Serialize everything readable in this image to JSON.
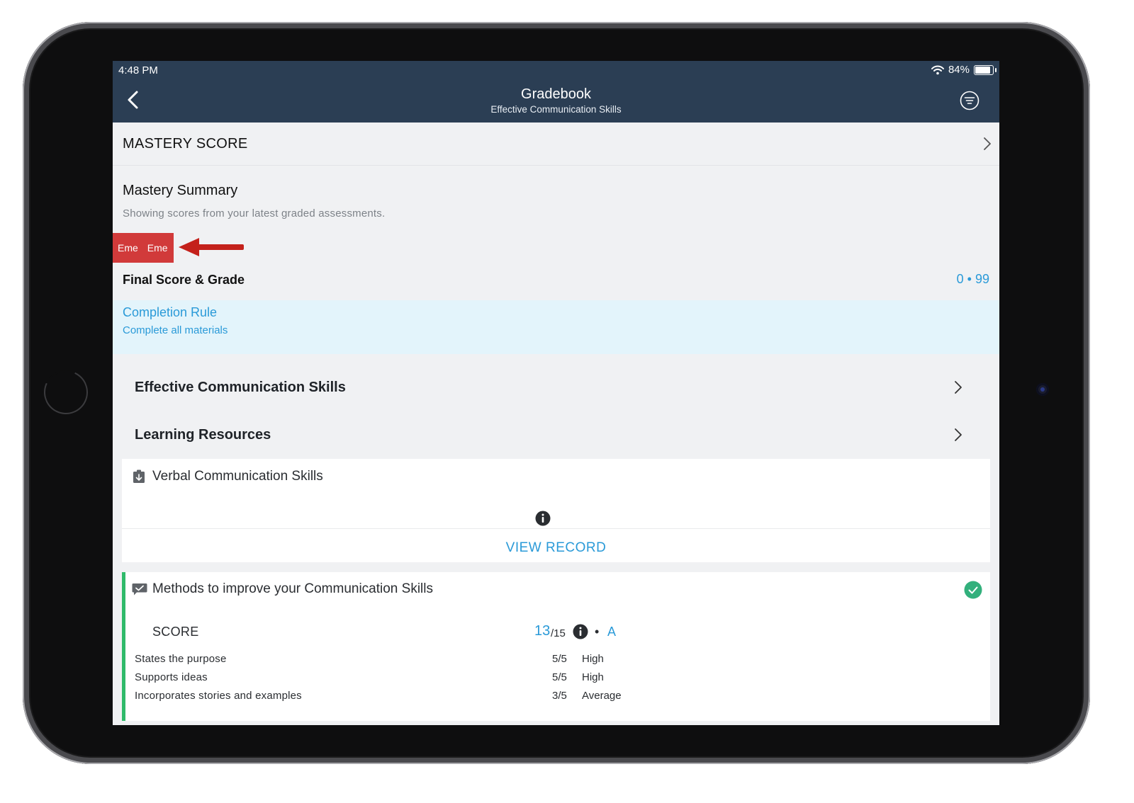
{
  "status": {
    "time": "4:48 PM",
    "battery": "84%"
  },
  "nav": {
    "title": "Gradebook",
    "subtitle": "Effective Communication Skills"
  },
  "mastery": {
    "header": "MASTERY SCORE"
  },
  "summary": {
    "title": "Mastery Summary",
    "description": "Showing scores from your latest graded assessments.",
    "badges": [
      "Eme",
      "Eme"
    ]
  },
  "final_score": {
    "label": "Final Score & Grade",
    "value": "0 • 99"
  },
  "completion": {
    "title": "Completion Rule",
    "detail": "Complete all materials"
  },
  "sections": [
    "Effective Communication Skills",
    "Learning Resources"
  ],
  "card_verbal": {
    "title": "Verbal Communication Skills",
    "action": "VIEW RECORD"
  },
  "card_methods": {
    "title": "Methods to improve your Communication Skills",
    "score_label": "SCORE",
    "score": "13",
    "score_total": "/15",
    "dot": "•",
    "grade": "A",
    "criteria": [
      {
        "name": "States the purpose",
        "value": "5/5",
        "level": "High"
      },
      {
        "name": "Supports ideas",
        "value": "5/5",
        "level": "High"
      },
      {
        "name": "Incorporates stories and examples",
        "value": "3/5",
        "level": "Average"
      }
    ]
  },
  "colors": {
    "navbar": "#2b3e54",
    "accent": "#2a9ad8",
    "badge": "#d13a3a",
    "arrow": "#c4211b",
    "complete": "#2fba6a"
  },
  "icons": [
    "back-chevron-icon",
    "filter-icon",
    "wifi-icon",
    "battery-icon",
    "chevron-right-icon",
    "assignment-download-icon",
    "info-icon",
    "discussion-icon",
    "check-circle-icon",
    "red-arrow-icon"
  ]
}
